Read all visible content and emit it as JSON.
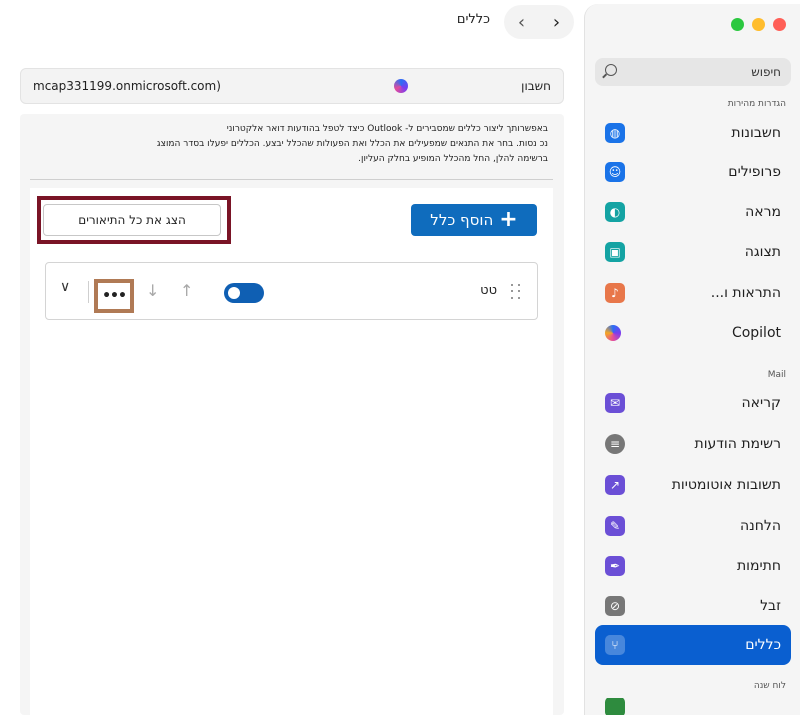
{
  "header": {
    "title": "כללים",
    "back_icon": "‹",
    "forward_icon": "›"
  },
  "account": {
    "label": "חשבון",
    "email": "mcap331199.onmicrosoft.com)"
  },
  "description": {
    "line1": "באפשרותך ליצור כללים שמסבירים ל- Outlook כיצד לטפל בהודעות דואר אלקטרוני",
    "line2": "נכ נסות. בחר את התנאים שמפעילים את הכלל ואת הפעולות שהכלל יבצע. הכללים יפעלו בסדר המוצג",
    "line3": "ברשימה להלן, החל מהכלל המופיע בחלק העליון."
  },
  "toolbar": {
    "add_rule": "הוסף כלל",
    "show_all": "הצג את כל התיאורים"
  },
  "rules": [
    {
      "name": "טט",
      "enabled": true
    }
  ],
  "sidebar": {
    "search_placeholder": "חיפוש",
    "quick_settings_label": "הגדרות מהירות",
    "mail_label": "Mail",
    "calendar_label": "לוח שנה",
    "items": [
      {
        "label": "חשבונות",
        "icon": "globe-icon",
        "color": "#1a73e8"
      },
      {
        "label": "פרופילים",
        "icon": "profile-icon",
        "color": "#1a73e8"
      },
      {
        "label": "מראה",
        "icon": "palette-icon",
        "color": "#14a3a3"
      },
      {
        "label": "תצוגה",
        "icon": "layout-icon",
        "color": "#14a3a3"
      },
      {
        "label": "התראות ו...",
        "icon": "bell-icon",
        "color": "#e8774a"
      },
      {
        "label": "Copilot",
        "icon": "copilot-icon",
        "color": "#7a3cf0"
      },
      {
        "label": "קריאה",
        "icon": "envelope-open-icon",
        "color": "#6b4fd6"
      },
      {
        "label": "רשימת הודעות",
        "icon": "message-list-icon",
        "color": "#777777"
      },
      {
        "label": "תשובות אוטומטיות",
        "icon": "reply-icon",
        "color": "#6b4fd6"
      },
      {
        "label": "הלחנה",
        "icon": "compose-icon",
        "color": "#6b4fd6"
      },
      {
        "label": "חתימות",
        "icon": "signature-icon",
        "color": "#6b4fd6"
      },
      {
        "label": "זבל",
        "icon": "junk-icon",
        "color": "#777777"
      },
      {
        "label": "כללים",
        "icon": "rules-icon",
        "color": "#ffffff",
        "active": true
      }
    ]
  }
}
